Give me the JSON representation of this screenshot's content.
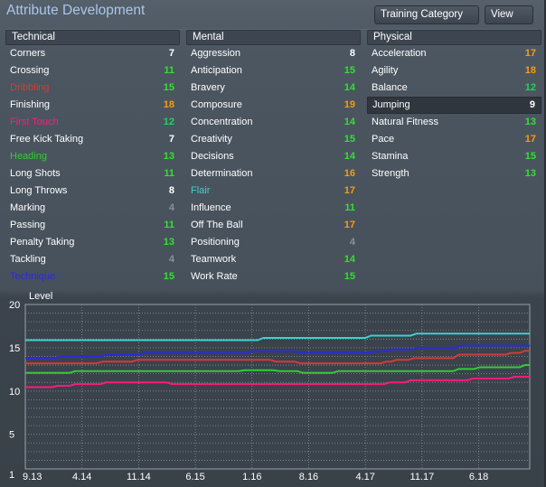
{
  "title": "Attribute Development",
  "buttons": {
    "training_category": "Training Category",
    "view": "View"
  },
  "colors": {
    "white": "#ffffff",
    "grey": "#8a9096",
    "green": "#33e033",
    "green2": "#22d060",
    "orange": "#f59a1a",
    "red": "#d43a3a",
    "pink": "#ff1a7a",
    "lime": "#33cc33",
    "cyan": "#3ecfd0",
    "blue": "#2a2ae0"
  },
  "columns": [
    {
      "header": "Technical",
      "items": [
        {
          "name": "Corners",
          "value": "7",
          "name_color": "white",
          "value_color": "white"
        },
        {
          "name": "Crossing",
          "value": "11",
          "name_color": "white",
          "value_color": "green"
        },
        {
          "name": "Dribbling",
          "value": "15",
          "name_color": "red",
          "value_color": "green"
        },
        {
          "name": "Finishing",
          "value": "18",
          "name_color": "white",
          "value_color": "orange"
        },
        {
          "name": "First Touch",
          "value": "12",
          "name_color": "pink",
          "value_color": "green2"
        },
        {
          "name": "Free Kick Taking",
          "value": "7",
          "name_color": "white",
          "value_color": "white"
        },
        {
          "name": "Heading",
          "value": "13",
          "name_color": "lime",
          "value_color": "green"
        },
        {
          "name": "Long Shots",
          "value": "11",
          "name_color": "white",
          "value_color": "green"
        },
        {
          "name": "Long Throws",
          "value": "8",
          "name_color": "white",
          "value_color": "white"
        },
        {
          "name": "Marking",
          "value": "4",
          "name_color": "white",
          "value_color": "grey"
        },
        {
          "name": "Passing",
          "value": "11",
          "name_color": "white",
          "value_color": "green"
        },
        {
          "name": "Penalty Taking",
          "value": "13",
          "name_color": "white",
          "value_color": "green"
        },
        {
          "name": "Tackling",
          "value": "4",
          "name_color": "white",
          "value_color": "grey"
        },
        {
          "name": "Technique",
          "value": "15",
          "name_color": "blue",
          "value_color": "green"
        }
      ]
    },
    {
      "header": "Mental",
      "items": [
        {
          "name": "Aggression",
          "value": "8",
          "name_color": "white",
          "value_color": "white"
        },
        {
          "name": "Anticipation",
          "value": "15",
          "name_color": "white",
          "value_color": "green"
        },
        {
          "name": "Bravery",
          "value": "14",
          "name_color": "white",
          "value_color": "green"
        },
        {
          "name": "Composure",
          "value": "19",
          "name_color": "white",
          "value_color": "orange"
        },
        {
          "name": "Concentration",
          "value": "14",
          "name_color": "white",
          "value_color": "green"
        },
        {
          "name": "Creativity",
          "value": "15",
          "name_color": "white",
          "value_color": "green"
        },
        {
          "name": "Decisions",
          "value": "14",
          "name_color": "white",
          "value_color": "green"
        },
        {
          "name": "Determination",
          "value": "16",
          "name_color": "white",
          "value_color": "orange"
        },
        {
          "name": "Flair",
          "value": "17",
          "name_color": "cyan",
          "value_color": "orange"
        },
        {
          "name": "Influence",
          "value": "11",
          "name_color": "white",
          "value_color": "green"
        },
        {
          "name": "Off The Ball",
          "value": "17",
          "name_color": "white",
          "value_color": "orange"
        },
        {
          "name": "Positioning",
          "value": "4",
          "name_color": "white",
          "value_color": "grey"
        },
        {
          "name": "Teamwork",
          "value": "14",
          "name_color": "white",
          "value_color": "green"
        },
        {
          "name": "Work Rate",
          "value": "15",
          "name_color": "white",
          "value_color": "green"
        }
      ]
    },
    {
      "header": "Physical",
      "items": [
        {
          "name": "Acceleration",
          "value": "17",
          "name_color": "white",
          "value_color": "orange"
        },
        {
          "name": "Agility",
          "value": "18",
          "name_color": "white",
          "value_color": "orange"
        },
        {
          "name": "Balance",
          "value": "12",
          "name_color": "white",
          "value_color": "green2"
        },
        {
          "name": "Jumping",
          "value": "9",
          "name_color": "white",
          "value_color": "white",
          "selected": true
        },
        {
          "name": "Natural Fitness",
          "value": "13",
          "name_color": "white",
          "value_color": "green"
        },
        {
          "name": "Pace",
          "value": "17",
          "name_color": "white",
          "value_color": "orange"
        },
        {
          "name": "Stamina",
          "value": "15",
          "name_color": "white",
          "value_color": "green"
        },
        {
          "name": "Strength",
          "value": "13",
          "name_color": "white",
          "value_color": "green"
        }
      ]
    }
  ],
  "chart_data": {
    "type": "line",
    "ylabel": "Level",
    "ylim": [
      1,
      20
    ],
    "yticks": [
      20,
      15,
      10,
      5,
      1
    ],
    "xticks": [
      "9.13",
      "4.14",
      "11.14",
      "6.15",
      "1.16",
      "8.16",
      "4.17",
      "11.17",
      "6.18"
    ],
    "xlim": [
      0,
      8.9
    ],
    "grid": true,
    "series": [
      {
        "name": "Flair",
        "color": "#3ecfd0",
        "steps": [
          [
            0,
            15.87
          ],
          [
            4.1,
            16.14
          ],
          [
            6.0,
            16.4
          ],
          [
            6.8,
            16.63
          ]
        ]
      },
      {
        "name": "Technique",
        "color": "#2a2ae0",
        "steps": [
          [
            0,
            13.8
          ],
          [
            0.53,
            14.0
          ],
          [
            1.33,
            14.2
          ],
          [
            2.0,
            14.4
          ],
          [
            3.9,
            14.6
          ],
          [
            4.75,
            14.4
          ],
          [
            6.09,
            14.6
          ],
          [
            6.33,
            14.8
          ],
          [
            6.82,
            15.0
          ],
          [
            7.6,
            15.25
          ]
        ]
      },
      {
        "name": "Dribbling",
        "color": "#d43a3a",
        "steps": [
          [
            0,
            13.2
          ],
          [
            1.26,
            13.4
          ],
          [
            1.88,
            13.6
          ],
          [
            4.32,
            13.4
          ],
          [
            4.75,
            13.2
          ],
          [
            6.27,
            13.4
          ],
          [
            6.45,
            13.6
          ],
          [
            6.76,
            13.8
          ],
          [
            7.55,
            14.2
          ],
          [
            8.47,
            14.4
          ],
          [
            8.72,
            14.65
          ]
        ]
      },
      {
        "name": "Heading",
        "color": "#33cc33",
        "steps": [
          [
            0,
            12.1
          ],
          [
            0.78,
            12.3
          ],
          [
            3.77,
            12.4
          ],
          [
            4.38,
            12.3
          ],
          [
            4.8,
            12.1
          ],
          [
            5.42,
            12.3
          ],
          [
            7.55,
            12.55
          ],
          [
            7.92,
            12.75
          ],
          [
            8.72,
            13.0
          ]
        ]
      },
      {
        "name": "First Touch",
        "color": "#ff1a7a",
        "steps": [
          [
            0,
            10.45
          ],
          [
            0.47,
            10.6
          ],
          [
            0.78,
            10.8
          ],
          [
            1.33,
            11.0
          ],
          [
            2.49,
            10.8
          ],
          [
            6.33,
            11.0
          ],
          [
            6.7,
            11.25
          ],
          [
            7.8,
            11.45
          ],
          [
            8.53,
            11.65
          ]
        ]
      }
    ]
  }
}
